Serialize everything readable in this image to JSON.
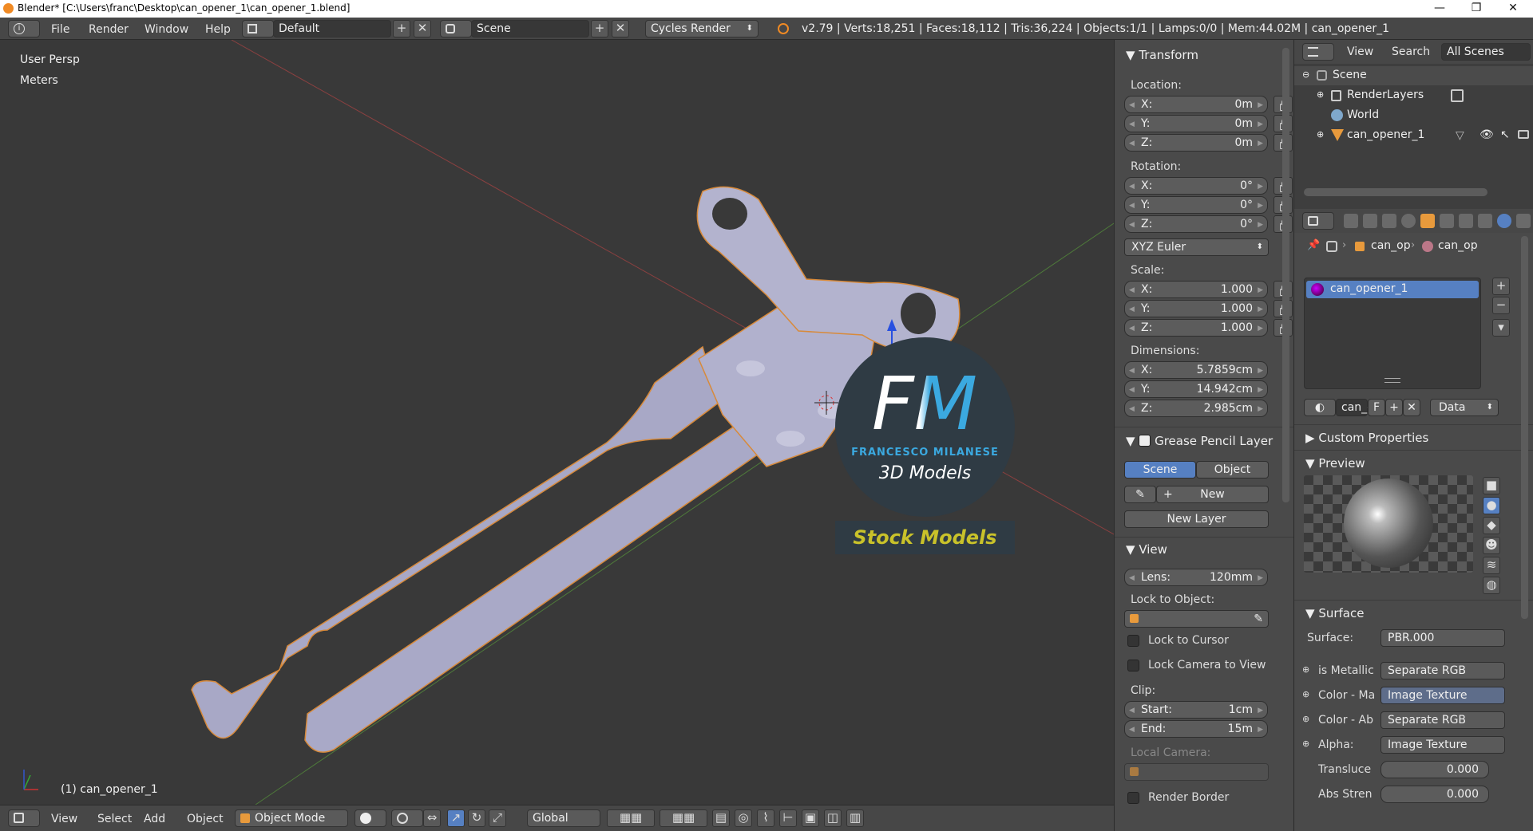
{
  "window": {
    "title": "Blender* [C:\\Users\\franc\\Desktop\\can_opener_1\\can_opener_1.blend]",
    "minimize": "—",
    "maximize": "❐",
    "close": "✕"
  },
  "infobar": {
    "menus": [
      "File",
      "Render",
      "Window",
      "Help"
    ],
    "screen_layout": "Default",
    "scene": "Scene",
    "render_engine": "Cycles Render",
    "stats": "v2.79 | Verts:18,251 | Faces:18,112 | Tris:36,224 | Objects:1/1 | Lamps:0/0 | Mem:44.02M | can_opener_1"
  },
  "viewport": {
    "view_name": "User Persp",
    "units": "Meters",
    "object_label": "(1) can_opener_1",
    "watermark": {
      "logo_letters": "FM",
      "brand": "FRANCESCO MILANESE",
      "subtitle": "3D Models",
      "banner": "Stock Models"
    }
  },
  "viewport_header": {
    "menus": [
      "View",
      "Select",
      "Add",
      "Object"
    ],
    "mode": "Object Mode",
    "orientation": "Global"
  },
  "npanel": {
    "transform": {
      "title": "Transform",
      "location_label": "Location:",
      "location": [
        {
          "k": "X:",
          "v": "0m"
        },
        {
          "k": "Y:",
          "v": "0m"
        },
        {
          "k": "Z:",
          "v": "0m"
        }
      ],
      "rotation_label": "Rotation:",
      "rotation": [
        {
          "k": "X:",
          "v": "0°"
        },
        {
          "k": "Y:",
          "v": "0°"
        },
        {
          "k": "Z:",
          "v": "0°"
        }
      ],
      "rotation_mode": "XYZ Euler",
      "scale_label": "Scale:",
      "scale": [
        {
          "k": "X:",
          "v": "1.000"
        },
        {
          "k": "Y:",
          "v": "1.000"
        },
        {
          "k": "Z:",
          "v": "1.000"
        }
      ],
      "dimensions_label": "Dimensions:",
      "dimensions": [
        {
          "k": "X:",
          "v": "5.7859cm"
        },
        {
          "k": "Y:",
          "v": "14.942cm"
        },
        {
          "k": "Z:",
          "v": "2.985cm"
        }
      ]
    },
    "grease_pencil": {
      "title": "Grease Pencil Layer",
      "tab_scene": "Scene",
      "tab_object": "Object",
      "new_label": "New",
      "new_layer_label": "New Layer"
    },
    "view": {
      "title": "View",
      "lens_label": "Lens:",
      "lens_value": "120mm",
      "lock_to_object": "Lock to Object:",
      "lock_to_cursor": "Lock to Cursor",
      "lock_camera": "Lock Camera to View",
      "clip_label": "Clip:",
      "clip_start_label": "Start:",
      "clip_start": "1cm",
      "clip_end_label": "End:",
      "clip_end": "15m",
      "local_camera": "Local Camera:",
      "render_border": "Render Border"
    }
  },
  "outliner": {
    "header": {
      "view": "View",
      "search": "Search",
      "filter": "All Scenes"
    },
    "items": [
      {
        "label": "Scene"
      },
      {
        "label": "RenderLayers"
      },
      {
        "label": "World"
      },
      {
        "label": "can_opener_1"
      }
    ]
  },
  "properties": {
    "breadcrumb": [
      "can_op",
      "can_op"
    ],
    "material_slot": "can_opener_1",
    "datablock_name": "can_o",
    "fake_user": "F",
    "link_mode": "Data",
    "custom_properties": "Custom Properties",
    "preview": "Preview",
    "surface_title": "Surface",
    "surface_rows": [
      {
        "label": "Surface:",
        "value": "PBR.000"
      },
      {
        "label": "is Metallic",
        "value": "Separate RGB"
      },
      {
        "label": "Color - Ma",
        "value": "Image Texture"
      },
      {
        "label": "Color - Ab",
        "value": "Separate RGB"
      },
      {
        "label": "Alpha:",
        "value": "Image Texture"
      }
    ],
    "sliders": [
      {
        "label": "Transluce",
        "value": "0.000"
      },
      {
        "label": "Abs Stren",
        "value": "0.000"
      }
    ]
  },
  "colors": {
    "accent": "#5680c2",
    "selection": "#f5a623",
    "logo_blue": "#3ba9e0",
    "banner_yellow": "#c9c22a"
  }
}
